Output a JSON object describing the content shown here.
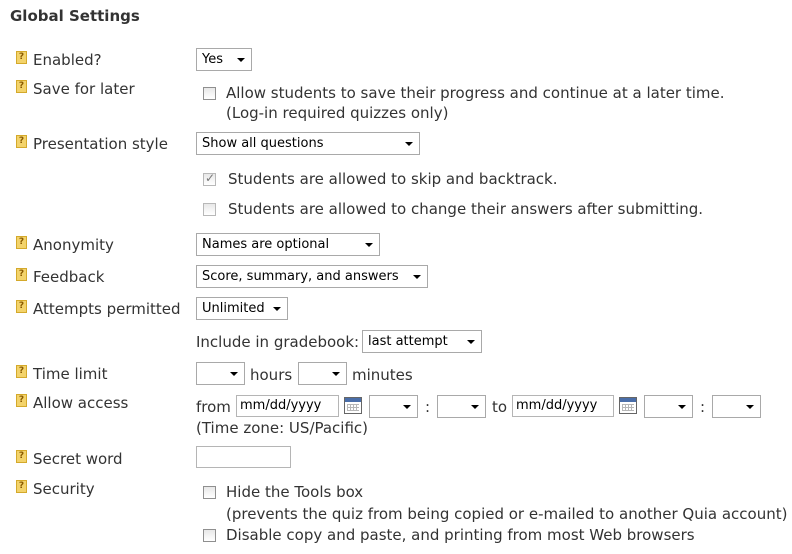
{
  "title": "Global Settings",
  "enabled": {
    "label": "Enabled?",
    "value": "Yes"
  },
  "save_later": {
    "label": "Save for later",
    "checkbox_label": "Allow students to save their progress and continue at a later time.",
    "note": "(Log-in required quizzes only)",
    "checked": false
  },
  "presentation": {
    "label": "Presentation style",
    "value": "Show all questions",
    "skip_label": "Students are allowed to skip and backtrack.",
    "skip_checked": true,
    "change_label": "Students are allowed to change their answers after submitting.",
    "change_checked": false
  },
  "anonymity": {
    "label": "Anonymity",
    "value": "Names are optional"
  },
  "feedback": {
    "label": "Feedback",
    "value": "Score, summary, and answers"
  },
  "attempts": {
    "label": "Attempts permitted",
    "value": "Unlimited",
    "gradebook_label": "Include in gradebook:",
    "gradebook_value": "last attempt"
  },
  "time_limit": {
    "label": "Time limit",
    "hours_value": "",
    "hours_label": "hours",
    "minutes_value": "",
    "minutes_label": "minutes"
  },
  "allow_access": {
    "label": "Allow access",
    "from_label": "from",
    "from_date": "mm/dd/yyyy",
    "colon": ":",
    "to_label": "to",
    "to_date": "mm/dd/yyyy",
    "timezone": "(Time zone: US/Pacific)"
  },
  "secret_word": {
    "label": "Secret word",
    "value": ""
  },
  "security": {
    "label": "Security",
    "hide_tools_label": "Hide the Tools box",
    "hide_tools_note": "(prevents the quiz from being copied or e-mailed to another Quia account)",
    "disable_copy_label": "Disable copy and paste, and printing from most Web browsers"
  },
  "help_glyph": "?"
}
